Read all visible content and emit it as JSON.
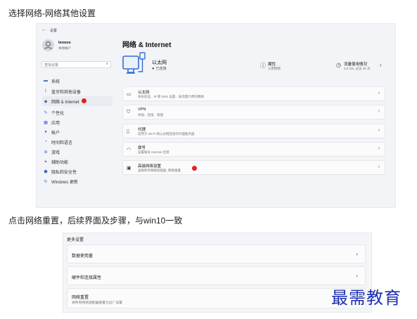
{
  "captions": {
    "top": "选择网络-网络其他设置",
    "middle": "点击网络重置，后续界面及步骤，与win10一致"
  },
  "settings_window": {
    "back_arrow": "←",
    "app_title": "设置",
    "user": {
      "name": "lenovo",
      "account": "本地帐户"
    },
    "search_placeholder": "查找设置",
    "sidebar": [
      {
        "icon": "home-icon",
        "label": "系统"
      },
      {
        "icon": "bluetooth-icon",
        "label": "蓝牙和其他设备"
      },
      {
        "icon": "network-icon",
        "label": "网络 & Internet",
        "active": true
      },
      {
        "icon": "brush-icon",
        "label": "个性化"
      },
      {
        "icon": "apps-icon",
        "label": "应用"
      },
      {
        "icon": "person-icon",
        "label": "帐户"
      },
      {
        "icon": "clock-icon",
        "label": "时间和语言"
      },
      {
        "icon": "game-icon",
        "label": "游戏"
      },
      {
        "icon": "accessibility-icon",
        "label": "辅助功能"
      },
      {
        "icon": "shield-icon",
        "label": "隐私和安全性"
      },
      {
        "icon": "update-icon",
        "label": "Windows 更新"
      }
    ],
    "page_title": "网络 & Internet",
    "connection": {
      "name": "以太网",
      "status": "已连接"
    },
    "properties": {
      "title": "属性",
      "subtitle": "公用网络"
    },
    "data_usage": {
      "title": "流量使用情况",
      "subtitle": "3.6 GB, 过去 30 天"
    },
    "cards": [
      {
        "icon": "ethernet-icon",
        "title": "以太网",
        "subtitle": "身份验证、IP 和 DNS 设置、按流量计费的网络"
      },
      {
        "icon": "vpn-icon",
        "title": "VPN",
        "subtitle": "添加、连接、管理"
      },
      {
        "icon": "proxy-icon",
        "title": "代理",
        "subtitle": "适用于 Wi-Fi 和以太网连接的代理服务器"
      },
      {
        "icon": "dialup-icon",
        "title": "拨号",
        "subtitle": "设置拨号 Internet 连接"
      },
      {
        "icon": "advanced-network-icon",
        "title": "高级网络设置",
        "subtitle": "查看所有网络适配器, 网络重置"
      }
    ],
    "marker_color": "#e02020"
  },
  "more_settings": {
    "header": "更多设置",
    "rows": [
      {
        "title": "数据使用量",
        "subtitle": ""
      },
      {
        "title": "硬件和连接属性",
        "subtitle": ""
      },
      {
        "title": "网络重置",
        "subtitle": "将所有网络适配器重置为出厂设置"
      }
    ]
  },
  "watermark": "最需教育"
}
